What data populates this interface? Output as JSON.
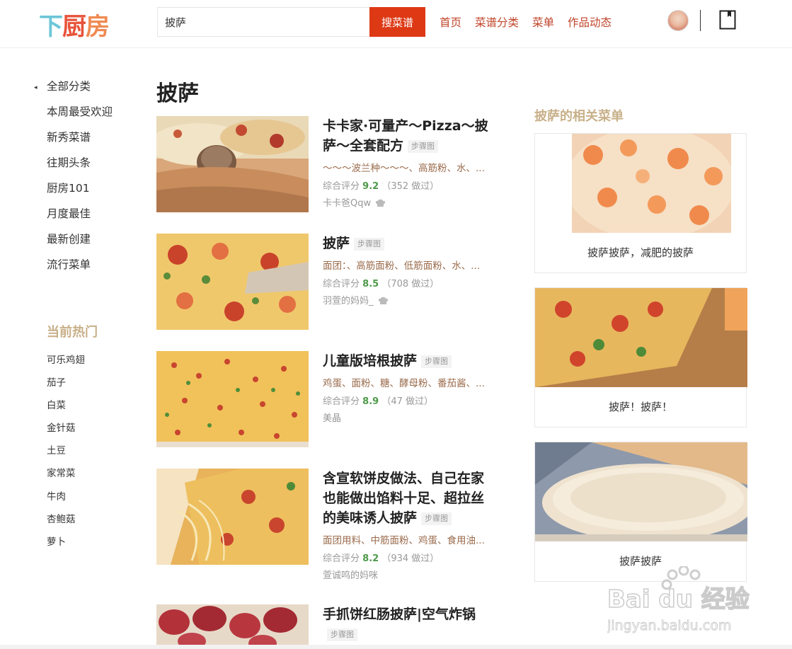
{
  "header": {
    "logo": [
      "下",
      "厨",
      "房"
    ],
    "search_value": "披萨",
    "search_button": "搜菜谱",
    "nav": [
      "首页",
      "菜谱分类",
      "菜单",
      "作品动态"
    ]
  },
  "sidebar": {
    "items": [
      "全部分类",
      "本周最受欢迎",
      "新秀菜谱",
      "往期头条",
      "厨房101",
      "月度最佳",
      "最新创建",
      "流行菜单"
    ],
    "hot_title": "当前热门",
    "hot": [
      "可乐鸡翅",
      "茄子",
      "白菜",
      "金针菇",
      "土豆",
      "家常菜",
      "牛肉",
      "杏鲍菇",
      "萝卜"
    ]
  },
  "main": {
    "title": "披萨",
    "recipes": [
      {
        "title": "卡卡家·可量产～Pizza～披萨～全套配方",
        "badge": "步骤图",
        "ingredients": "～～～波兰种～～～、高筋粉、水、...",
        "rating_label": "综合评分",
        "score": "9.2",
        "count": "（352 做过）",
        "author": "卡卡爸Qqw"
      },
      {
        "title": "披萨",
        "badge": "步骤图",
        "ingredients": "面团：、高筋面粉、低筋面粉、水、...",
        "rating_label": "综合评分",
        "score": "8.5",
        "count": "（708 做过）",
        "author": "羽萱的妈妈_"
      },
      {
        "title": "儿童版培根披萨",
        "badge": "步骤图",
        "ingredients": "鸡蛋、面粉、糖、酵母粉、番茄酱、...",
        "rating_label": "综合评分",
        "score": "8.9",
        "count": "（47 做过）",
        "author": "美晶"
      },
      {
        "title": "含宣软饼皮做法、自己在家也能做出馅料十足、超拉丝的美味诱人披萨",
        "badge": "步骤图",
        "ingredients": "面团用料、中筋面粉、鸡蛋、食用油...",
        "rating_label": "综合评分",
        "score": "8.2",
        "count": "（934 做过）",
        "author": "萱诚鸣的妈咪"
      },
      {
        "title": "手抓饼红肠披萨|空气炸锅",
        "badge": "步骤图"
      }
    ]
  },
  "related": {
    "title": "披萨的相关菜单",
    "cards": [
      "披萨披萨，减肥的披萨",
      "披萨！披萨！",
      "披萨披萨"
    ]
  },
  "watermark": {
    "brand": "Bai du 经验",
    "url": "jingyan.baidu.com"
  },
  "colors": {
    "accent": "#dd3915",
    "nav": "#c1452b",
    "section_title": "#c8b089",
    "score": "#4e9a4a"
  }
}
